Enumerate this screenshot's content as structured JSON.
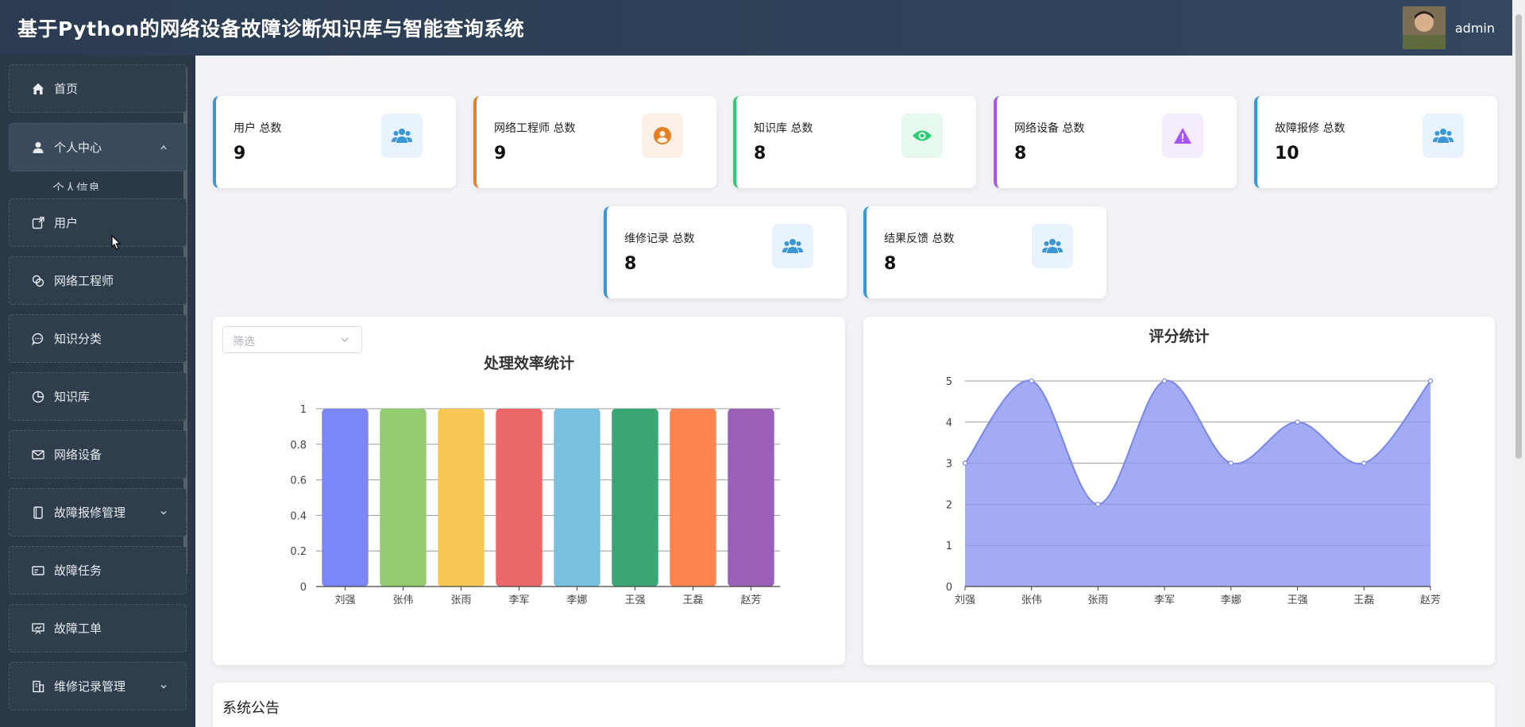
{
  "header": {
    "title": "基于Python的网络设备故障诊断知识库与智能查询系统",
    "username": "admin"
  },
  "sidebar": {
    "items": [
      {
        "label": "首页",
        "icon": "home-icon"
      },
      {
        "label": "个人中心",
        "icon": "user-icon"
      },
      {
        "label": "用户",
        "icon": "share-box-icon"
      },
      {
        "label": "网络工程师",
        "icon": "link-icon"
      },
      {
        "label": "知识分类",
        "icon": "chat-icon"
      },
      {
        "label": "知识库",
        "icon": "pie-icon"
      },
      {
        "label": "网络设备",
        "icon": "mail-icon"
      },
      {
        "label": "故障报修管理",
        "icon": "phone-icon"
      },
      {
        "label": "故障任务",
        "icon": "card-icon"
      },
      {
        "label": "故障工单",
        "icon": "presentation-icon"
      },
      {
        "label": "维修记录管理",
        "icon": "building-icon"
      }
    ],
    "submenu_label": "个人信息"
  },
  "stats": [
    {
      "label": "用户 总数",
      "value": "9",
      "color": "#3a97d4",
      "icon": "users-icon"
    },
    {
      "label": "网络工程师 总数",
      "value": "9",
      "color": "#e67e22",
      "icon": "person-circle-icon"
    },
    {
      "label": "知识库 总数",
      "value": "8",
      "color": "#2ecc71",
      "icon": "eye-icon"
    },
    {
      "label": "网络设备 总数",
      "value": "8",
      "color": "#a855f7",
      "icon": "warning-icon"
    },
    {
      "label": "故障报修 总数",
      "value": "10",
      "color": "#3a97d4",
      "icon": "users-icon"
    },
    {
      "label": "维修记录 总数",
      "value": "8",
      "color": "#3a97d4",
      "icon": "users-icon"
    },
    {
      "label": "结果反馈 总数",
      "value": "8",
      "color": "#3a97d4",
      "icon": "users-icon"
    }
  ],
  "filter": {
    "placeholder": "筛选"
  },
  "notice": {
    "title": "系统公告"
  },
  "chart_data": [
    {
      "type": "bar",
      "title": "处理效率统计",
      "categories": [
        "刘强",
        "张伟",
        "张雨",
        "李军",
        "李娜",
        "王强",
        "王磊",
        "赵芳"
      ],
      "values": [
        1,
        1,
        1,
        1,
        1,
        1,
        1,
        1
      ],
      "colors": [
        "#7b86f7",
        "#93cc6e",
        "#f8c857",
        "#ec6768",
        "#78bfe0",
        "#3ba573",
        "#fc8550",
        "#9a5fb6"
      ],
      "yticks": [
        "0",
        "0.2",
        "0.4",
        "0.6",
        "0.8",
        "1"
      ],
      "ylim": [
        0,
        1
      ],
      "grid": true
    },
    {
      "type": "area",
      "title": "评分统计",
      "categories": [
        "刘强",
        "张伟",
        "张雨",
        "李军",
        "李娜",
        "王强",
        "王磊",
        "赵芳"
      ],
      "values": [
        3,
        5,
        2,
        5,
        3,
        4,
        3,
        5
      ],
      "color": "#8c96f2",
      "yticks": [
        "0",
        "1",
        "2",
        "3",
        "4",
        "5"
      ],
      "ylim": [
        0,
        5
      ],
      "grid": true
    }
  ]
}
